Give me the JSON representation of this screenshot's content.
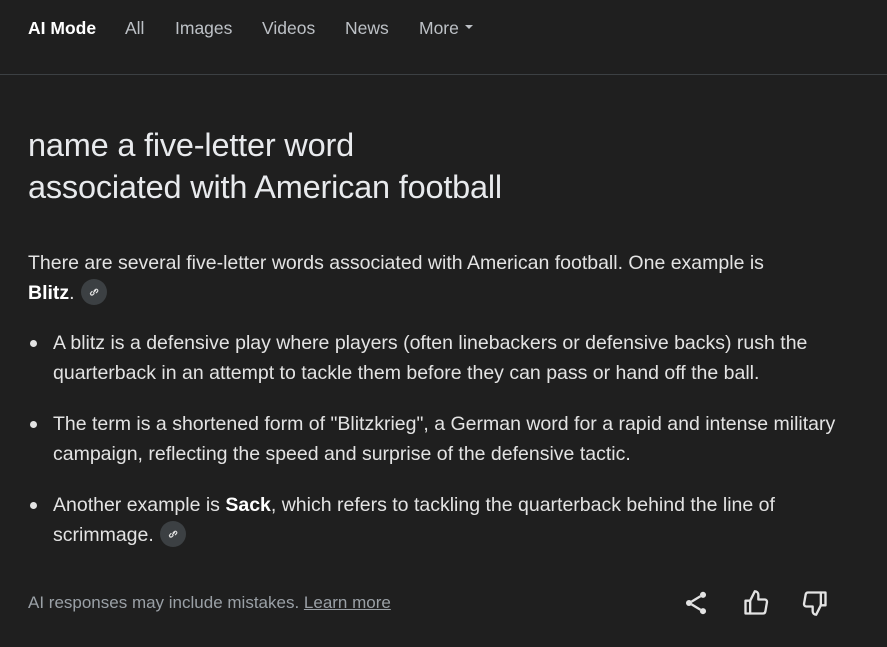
{
  "nav": {
    "tabs": [
      {
        "label": "AI Mode",
        "active": true
      },
      {
        "label": "All"
      },
      {
        "label": "Images"
      },
      {
        "label": "Videos"
      },
      {
        "label": "News"
      },
      {
        "label": "More"
      }
    ]
  },
  "question": {
    "line1": "name a five-letter word",
    "line2": "associated with American football"
  },
  "answer": {
    "intro": "There are several five-letter words associated with American football. One example is ",
    "intro_bold": "Blitz",
    "intro_end": ".",
    "bullets": [
      {
        "text": "A blitz is a defensive play where players (often linebackers or defensive backs) rush the quarterback in an attempt to tackle them before they can pass or hand off the ball."
      },
      {
        "text": "The term is a shortened form of \"Blitzkrieg\", a German word for a rapid and intense military campaign, reflecting the speed and surprise of the defensive tactic."
      },
      {
        "pre": "Another example is ",
        "bold": "Sack",
        "post": ", which refers to tackling the quarterback behind the line of scrimmage."
      }
    ]
  },
  "footer": {
    "disclaimer": "AI responses may include mistakes. ",
    "learn_more": "Learn more"
  },
  "icons": {
    "link": "link-icon",
    "share": "share-icon",
    "thumbs_up": "thumbs-up-icon",
    "thumbs_down": "thumbs-down-icon"
  },
  "colors": {
    "background": "#1f1f1f",
    "text": "#e3e3e3",
    "muted": "#9aa0a6",
    "divider": "#3c4043"
  }
}
